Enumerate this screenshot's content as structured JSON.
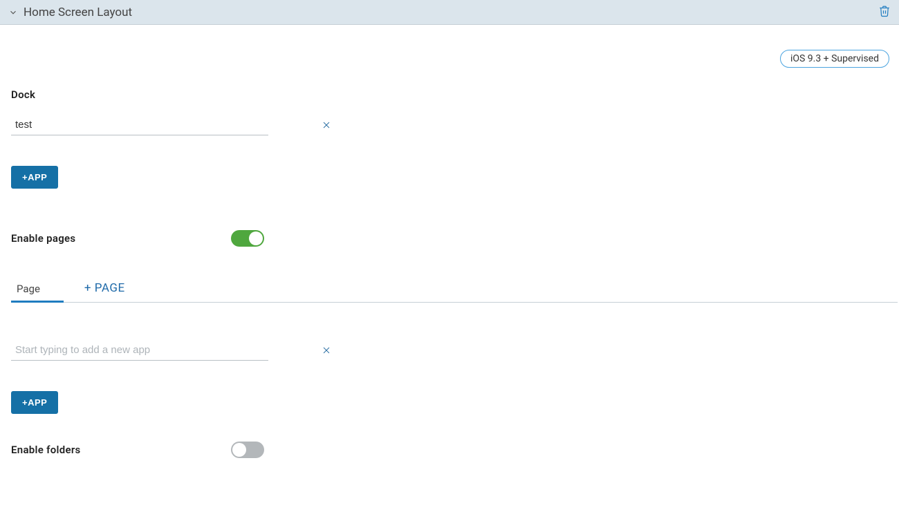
{
  "header": {
    "title": "Home Screen Layout"
  },
  "badge": "iOS 9.3 + Supervised",
  "dock": {
    "label": "Dock",
    "app_input": "test",
    "add_app_label": "+APP"
  },
  "enable_pages": {
    "label": "Enable pages",
    "on": true
  },
  "tabs": {
    "page_label": "Page",
    "add_page_label": "+ PAGE"
  },
  "page": {
    "app_input": "",
    "app_placeholder": "Start typing to add a new app",
    "add_app_label": "+APP"
  },
  "enable_folders": {
    "label": "Enable folders",
    "on": false
  }
}
